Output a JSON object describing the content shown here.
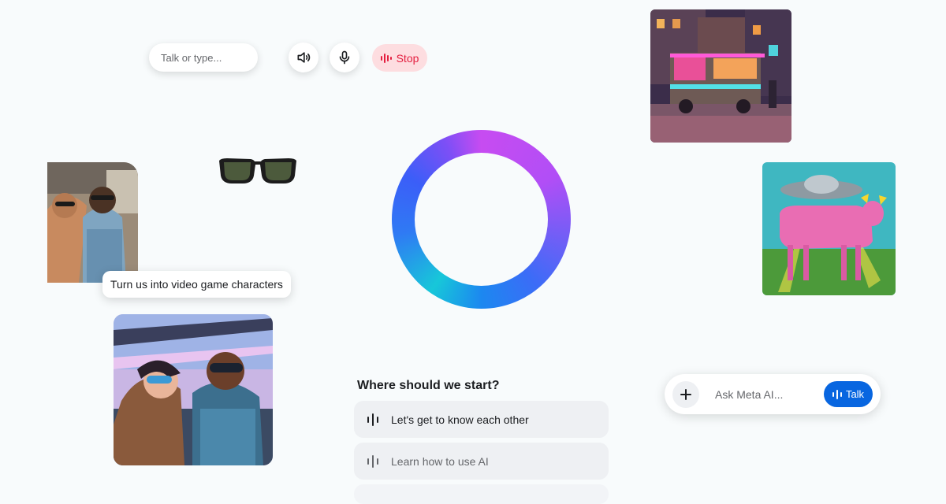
{
  "top_controls": {
    "talk_placeholder": "Talk or type...",
    "speaker_icon": "speaker-icon",
    "mic_icon": "microphone-icon",
    "stop_label": "Stop"
  },
  "images": {
    "food_truck": "pixel-art-food-truck",
    "couple_photo": "couple-in-car-photo",
    "sunglasses": "smart-glasses",
    "pink_cow": "pink-cow-ufo-illustration",
    "game_characters": "video-game-character-couple"
  },
  "prompt_bubble": {
    "text": "Turn us into video game characters"
  },
  "suggestions": {
    "title": "Where should we start?",
    "items": [
      {
        "label": "Let's get to know each other",
        "icon": "voice-waveform-icon"
      },
      {
        "label": "Learn how to use AI",
        "icon": "voice-waveform-icon"
      }
    ]
  },
  "ask_bar": {
    "placeholder": "Ask Meta AI...",
    "talk_label": "Talk"
  },
  "colors": {
    "accent_blue": "#0866e0",
    "stop_red": "#e41e3f",
    "stop_bg": "#fddde0",
    "ring_purple": "#c74cf1",
    "ring_blue": "#3b6cf7",
    "ring_cyan": "#17c7d9"
  }
}
